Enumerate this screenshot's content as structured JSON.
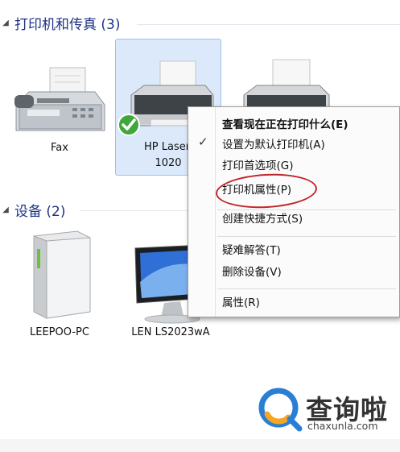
{
  "groups": {
    "printers": {
      "title": "打印机和传真 (3)"
    },
    "devices": {
      "title": "设备 (2)"
    }
  },
  "printers": [
    {
      "label": "Fax",
      "icon": "fax-machine-icon"
    },
    {
      "label_line1": "HP Laser.",
      "label_line2": "1020",
      "icon": "printer-icon",
      "selected": true,
      "default_badge": "check-badge-icon"
    },
    {
      "label": "",
      "icon": "printer-icon"
    }
  ],
  "devices": [
    {
      "label": "LEEPOO-PC",
      "icon": "computer-tower-icon"
    },
    {
      "label": "LEN LS2023wA",
      "icon": "monitor-icon"
    }
  ],
  "context_menu": {
    "items": [
      {
        "label": "查看现在正在打印什么(E)",
        "bold": true
      },
      {
        "label": "设置为默认打印机(A)",
        "checked": true
      },
      {
        "label": "打印首选项(G)"
      },
      {
        "label": "打印机属性(P)",
        "highlighted": true
      },
      {
        "label": "创建快捷方式(S)"
      },
      {
        "label": "疑难解答(T)"
      },
      {
        "label": "删除设备(V)"
      },
      {
        "label": "属性(R)"
      }
    ],
    "check_glyph": "✓"
  },
  "watermark": {
    "brand": "查询啦",
    "url": "chaxunla.com"
  },
  "colors": {
    "accent": "#c0262a",
    "selection": "#dbe9fb",
    "header": "#1e3287",
    "watermark_blue": "#2a7fd4",
    "watermark_orange": "#f5a623"
  }
}
